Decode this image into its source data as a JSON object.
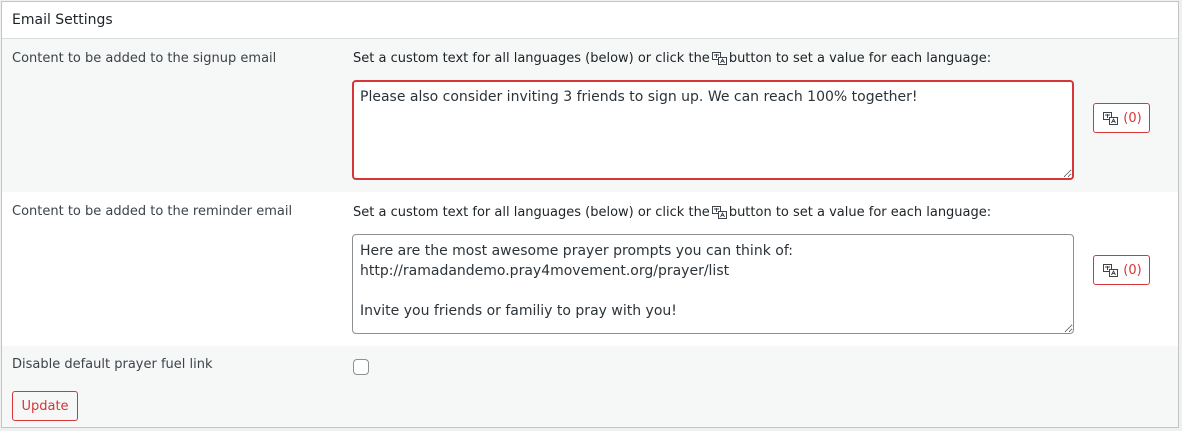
{
  "section": {
    "title": "Email Settings"
  },
  "signup": {
    "label": "Content to be added to the signup email",
    "desc_before": "Set a custom text for all languages (below) or click the",
    "desc_after": "button to set a value for each language:",
    "value": "Please also consider inviting 3 friends to sign up. We can reach 100% together!",
    "lang_button_count": "(0)",
    "lang_icon": "translate-icon"
  },
  "reminder": {
    "label": "Content to be added to the reminder email",
    "desc_before": "Set a custom text for all languages (below) or click the",
    "desc_after": "button to set a value for each language:",
    "value": "Here are the most awesome prayer prompts you can think of:\nhttp://ramadandemo.pray4movement.org/prayer/list\n\nInvite you friends or familiy to pray with you!",
    "lang_button_count": "(0)",
    "lang_icon": "translate-icon"
  },
  "disable_link": {
    "label": "Disable default prayer fuel link",
    "checked": false
  },
  "actions": {
    "update_label": "Update"
  },
  "colors": {
    "accent": "#d63638",
    "alt_row": "#f6f7f7",
    "border": "#c3c4c7"
  }
}
